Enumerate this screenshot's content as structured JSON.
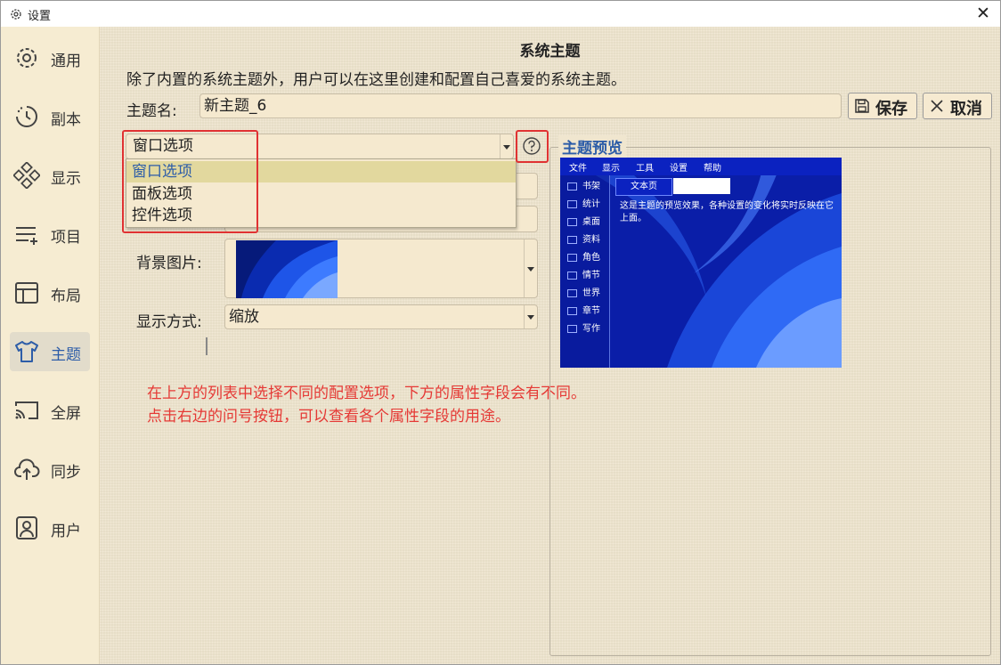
{
  "window": {
    "title": "设置",
    "close_glyph": "✕"
  },
  "sidebar": {
    "items": [
      {
        "label": "通用",
        "icon": "gear-icon"
      },
      {
        "label": "副本",
        "icon": "clock-icon"
      },
      {
        "label": "显示",
        "icon": "diamonds-icon"
      },
      {
        "label": "项目",
        "icon": "list-add-icon"
      },
      {
        "label": "布局",
        "icon": "layout-icon"
      },
      {
        "label": "主题",
        "icon": "tshirt-icon",
        "active": true
      },
      {
        "label": "全屏",
        "icon": "cast-icon"
      },
      {
        "label": "同步",
        "icon": "cloud-upload-icon"
      },
      {
        "label": "用户",
        "icon": "user-icon"
      }
    ]
  },
  "main": {
    "title": "系统主题",
    "description": "除了内置的系统主题外，用户可以在这里创建和配置自己喜爱的系统主题。",
    "theme_name_label": "主题名:",
    "theme_name_value": "新主题_6",
    "save_label": "保存",
    "cancel_label": "取消",
    "options_combo_value": "窗口选项",
    "options_dropdown": [
      "窗口选项",
      "面板选项",
      "控件选项"
    ],
    "bg_image_label": "背景图片:",
    "display_mode_label": "显示方式:",
    "display_mode_value": "缩放",
    "help_glyph": "?",
    "note_line1": "在上方的列表中选择不同的配置选项，下方的属性字段会有不同。",
    "note_line2": "点击右边的问号按钮，可以查看各个属性字段的用途。"
  },
  "preview": {
    "title": "主题预览",
    "menu": [
      "文件",
      "显示",
      "工具",
      "设置",
      "帮助"
    ],
    "side_items": [
      "书架",
      "统计",
      "桌面",
      "资料",
      "角色",
      "情节",
      "世界",
      "章节",
      "写作"
    ],
    "tab_label": "文本页",
    "body_text": "这是主题的预览效果，各种设置的变化将实时反映在它上面。"
  },
  "colors": {
    "accent": "#2d5da8",
    "annotation_red": "#e03232",
    "note_text": "#e53935",
    "background": "#f0e6cf"
  }
}
